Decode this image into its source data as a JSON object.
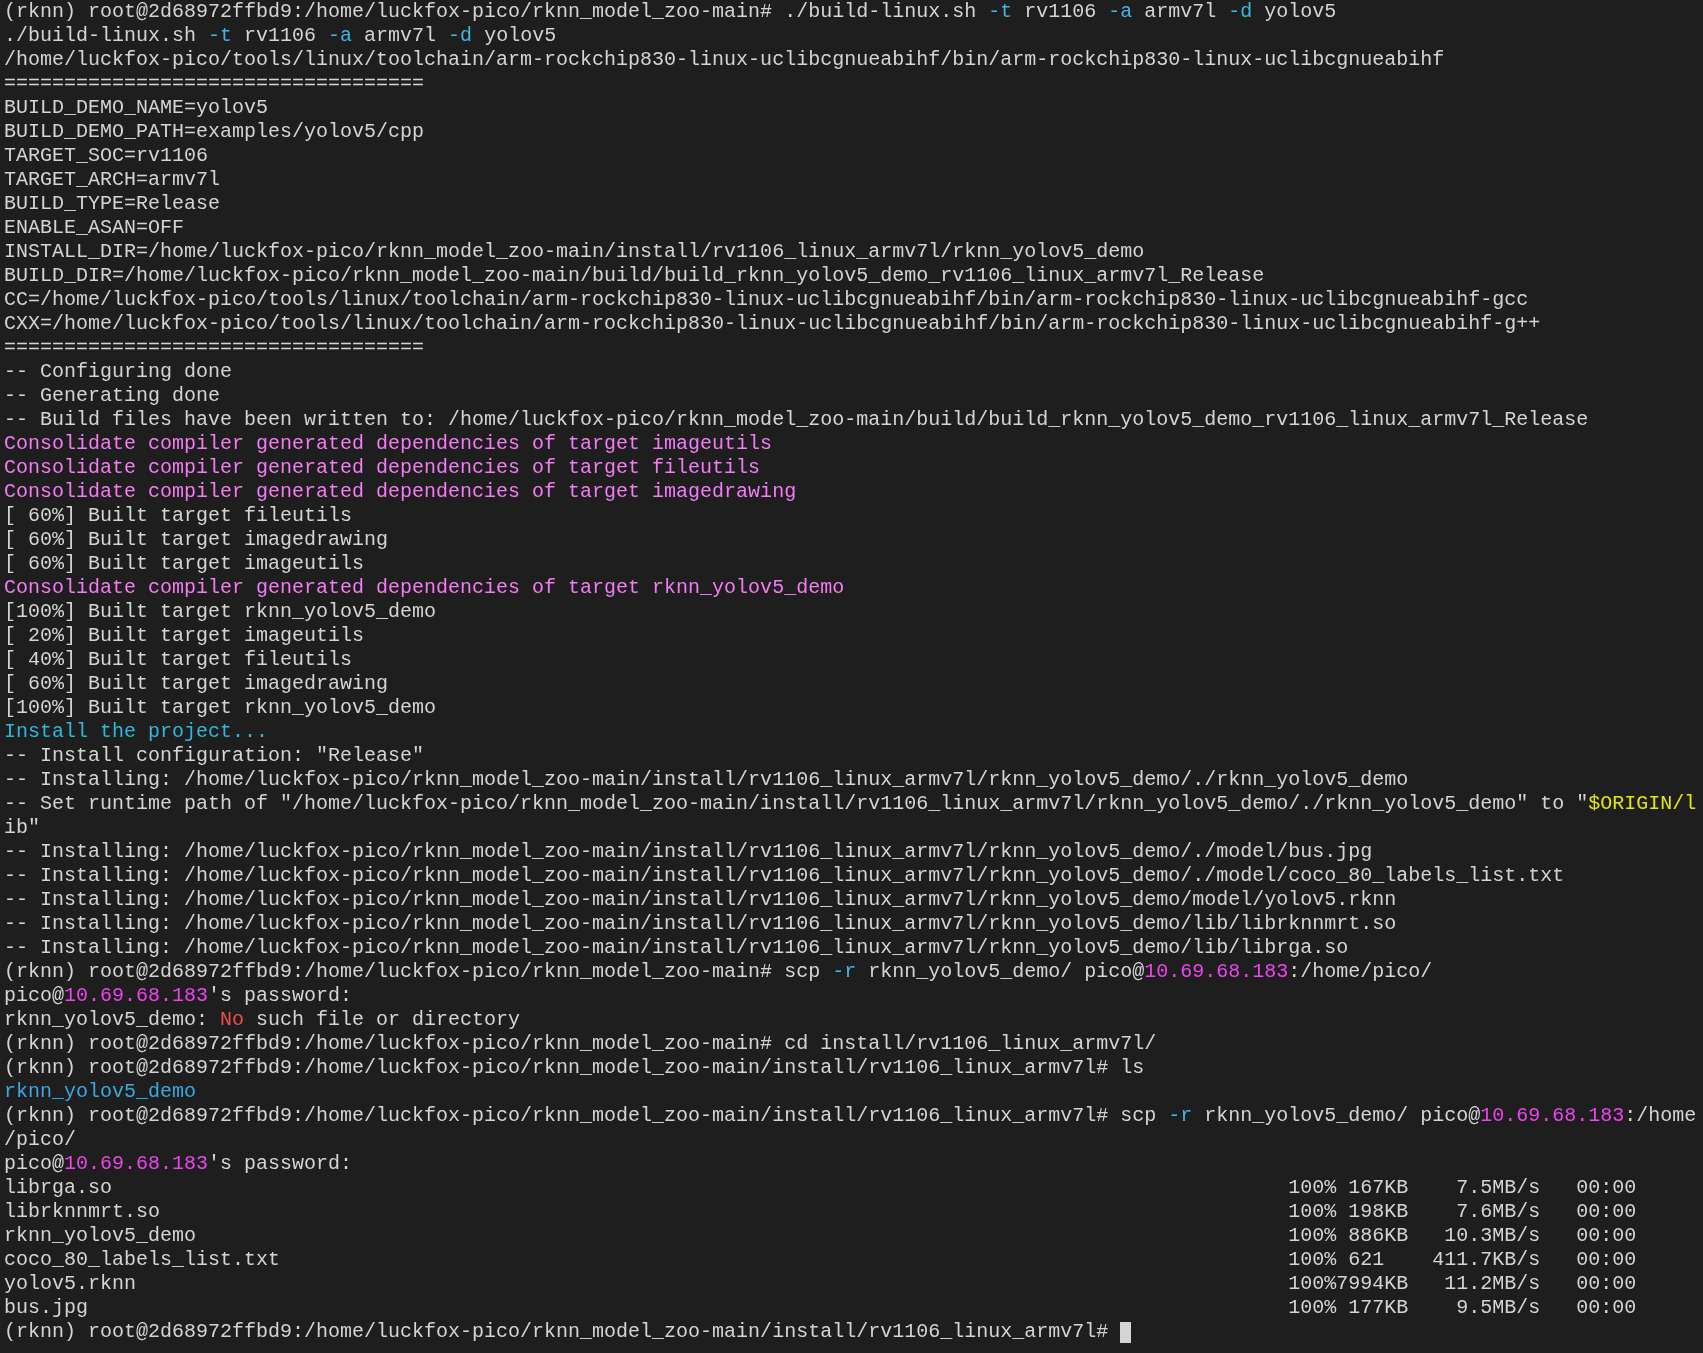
{
  "terminal": {
    "cursor_visible": true,
    "lines": [
      {
        "kind": "text",
        "segments": [
          {
            "text": "(rknn) root@2d68972ffbd9:/home/luckfox-pico/rknn_model_zoo-main# ./build-linux.sh "
          },
          {
            "text": "-t",
            "color": "#3fb6e6"
          },
          {
            "text": " rv1106 "
          },
          {
            "text": "-a",
            "color": "#3fb6e6"
          },
          {
            "text": " armv7l "
          },
          {
            "text": "-d",
            "color": "#3fb6e6"
          },
          {
            "text": " yolov5"
          }
        ]
      },
      {
        "kind": "text",
        "segments": [
          {
            "text": "./build-linux.sh "
          },
          {
            "text": "-t",
            "color": "#3fb6e6"
          },
          {
            "text": " rv1106 "
          },
          {
            "text": "-a",
            "color": "#3fb6e6"
          },
          {
            "text": " armv7l "
          },
          {
            "text": "-d",
            "color": "#3fb6e6"
          },
          {
            "text": " yolov5"
          }
        ]
      },
      {
        "kind": "text",
        "segments": [
          {
            "text": "/home/luckfox-pico/tools/linux/toolchain/arm-rockchip830-linux-uclibcgnueabihf/bin/arm-rockchip830-linux-uclibcgnueabihf"
          }
        ]
      },
      {
        "kind": "text",
        "segments": [
          {
            "text": "==================================="
          }
        ]
      },
      {
        "kind": "text",
        "segments": [
          {
            "text": "BUILD_DEMO_NAME=yolov5"
          }
        ]
      },
      {
        "kind": "text",
        "segments": [
          {
            "text": "BUILD_DEMO_PATH=examples/yolov5/cpp"
          }
        ]
      },
      {
        "kind": "text",
        "segments": [
          {
            "text": "TARGET_SOC=rv1106"
          }
        ]
      },
      {
        "kind": "text",
        "segments": [
          {
            "text": "TARGET_ARCH=armv7l"
          }
        ]
      },
      {
        "kind": "text",
        "segments": [
          {
            "text": "BUILD_TYPE=Release"
          }
        ]
      },
      {
        "kind": "text",
        "segments": [
          {
            "text": "ENABLE_ASAN=OFF"
          }
        ]
      },
      {
        "kind": "text",
        "segments": [
          {
            "text": "INSTALL_DIR=/home/luckfox-pico/rknn_model_zoo-main/install/rv1106_linux_armv7l/rknn_yolov5_demo"
          }
        ]
      },
      {
        "kind": "text",
        "segments": [
          {
            "text": "BUILD_DIR=/home/luckfox-pico/rknn_model_zoo-main/build/build_rknn_yolov5_demo_rv1106_linux_armv7l_Release"
          }
        ]
      },
      {
        "kind": "text",
        "segments": [
          {
            "text": "CC=/home/luckfox-pico/tools/linux/toolchain/arm-rockchip830-linux-uclibcgnueabihf/bin/arm-rockchip830-linux-uclibcgnueabihf-gcc"
          }
        ]
      },
      {
        "kind": "text",
        "segments": [
          {
            "text": "CXX=/home/luckfox-pico/tools/linux/toolchain/arm-rockchip830-linux-uclibcgnueabihf/bin/arm-rockchip830-linux-uclibcgnueabihf-g++"
          }
        ]
      },
      {
        "kind": "text",
        "segments": [
          {
            "text": "==================================="
          }
        ]
      },
      {
        "kind": "text",
        "segments": [
          {
            "text": "-- Configuring done"
          }
        ]
      },
      {
        "kind": "text",
        "segments": [
          {
            "text": "-- Generating done"
          }
        ]
      },
      {
        "kind": "text",
        "segments": [
          {
            "text": "-- Build files have been written to: /home/luckfox-pico/rknn_model_zoo-main/build/build_rknn_yolov5_demo_rv1106_linux_armv7l_Release"
          }
        ]
      },
      {
        "kind": "text",
        "segments": [
          {
            "text": "Consolidate compiler generated dependencies of target imageutils",
            "color": "#f47cf4"
          }
        ]
      },
      {
        "kind": "text",
        "segments": [
          {
            "text": "Consolidate compiler generated dependencies of target fileutils",
            "color": "#f47cf4"
          }
        ]
      },
      {
        "kind": "text",
        "segments": [
          {
            "text": "Consolidate compiler generated dependencies of target imagedrawing",
            "color": "#f47cf4"
          }
        ]
      },
      {
        "kind": "text",
        "segments": [
          {
            "text": "[ 60%] Built target fileutils"
          }
        ]
      },
      {
        "kind": "text",
        "segments": [
          {
            "text": "[ 60%] Built target imagedrawing"
          }
        ]
      },
      {
        "kind": "text",
        "segments": [
          {
            "text": "[ 60%] Built target imageutils"
          }
        ]
      },
      {
        "kind": "text",
        "segments": [
          {
            "text": "Consolidate compiler generated dependencies of target rknn_yolov5_demo",
            "color": "#f47cf4"
          }
        ]
      },
      {
        "kind": "text",
        "segments": [
          {
            "text": "[100%] Built target rknn_yolov5_demo"
          }
        ]
      },
      {
        "kind": "text",
        "segments": [
          {
            "text": "[ 20%] Built target imageutils"
          }
        ]
      },
      {
        "kind": "text",
        "segments": [
          {
            "text": "[ 40%] Built target fileutils"
          }
        ]
      },
      {
        "kind": "text",
        "segments": [
          {
            "text": "[ 60%] Built target imagedrawing"
          }
        ]
      },
      {
        "kind": "text",
        "segments": [
          {
            "text": "[100%] Built target rknn_yolov5_demo"
          }
        ]
      },
      {
        "kind": "text",
        "segments": [
          {
            "text": "Install the project...",
            "color": "#2fb8db"
          }
        ]
      },
      {
        "kind": "text",
        "segments": [
          {
            "text": "-- Install configuration: \"Release\""
          }
        ]
      },
      {
        "kind": "text",
        "segments": [
          {
            "text": "-- Installing: /home/luckfox-pico/rknn_model_zoo-main/install/rv1106_linux_armv7l/rknn_yolov5_demo/./rknn_yolov5_demo"
          }
        ]
      },
      {
        "kind": "text",
        "segments": [
          {
            "text": "-- Set runtime path of \"/home/luckfox-pico/rknn_model_zoo-main/install/rv1106_linux_armv7l/rknn_yolov5_demo/./rknn_yolov5_demo\" to \""
          },
          {
            "text": "$ORIGIN/l",
            "color": "#e5e510"
          }
        ]
      },
      {
        "kind": "text",
        "segments": [
          {
            "text": "ib\""
          }
        ]
      },
      {
        "kind": "text",
        "segments": [
          {
            "text": "-- Installing: /home/luckfox-pico/rknn_model_zoo-main/install/rv1106_linux_armv7l/rknn_yolov5_demo/./model/bus.jpg"
          }
        ]
      },
      {
        "kind": "text",
        "segments": [
          {
            "text": "-- Installing: /home/luckfox-pico/rknn_model_zoo-main/install/rv1106_linux_armv7l/rknn_yolov5_demo/./model/coco_80_labels_list.txt"
          }
        ]
      },
      {
        "kind": "text",
        "segments": [
          {
            "text": "-- Installing: /home/luckfox-pico/rknn_model_zoo-main/install/rv1106_linux_armv7l/rknn_yolov5_demo/model/yolov5.rknn"
          }
        ]
      },
      {
        "kind": "text",
        "segments": [
          {
            "text": "-- Installing: /home/luckfox-pico/rknn_model_zoo-main/install/rv1106_linux_armv7l/rknn_yolov5_demo/lib/librknnmrt.so"
          }
        ]
      },
      {
        "kind": "text",
        "segments": [
          {
            "text": "-- Installing: /home/luckfox-pico/rknn_model_zoo-main/install/rv1106_linux_armv7l/rknn_yolov5_demo/lib/librga.so"
          }
        ]
      },
      {
        "kind": "text",
        "segments": [
          {
            "text": "(rknn) root@2d68972ffbd9:/home/luckfox-pico/rknn_model_zoo-main# scp "
          },
          {
            "text": "-r",
            "color": "#3fb6e6"
          },
          {
            "text": " rknn_yolov5_demo/ pico@"
          },
          {
            "text": "10.69.68.183",
            "color": "#ee44ee"
          },
          {
            "text": ":/home/pico/"
          }
        ]
      },
      {
        "kind": "text",
        "segments": [
          {
            "text": "pico@"
          },
          {
            "text": "10.69.68.183",
            "color": "#ee44ee"
          },
          {
            "text": "'s password:"
          }
        ]
      },
      {
        "kind": "text",
        "segments": [
          {
            "text": "rknn_yolov5_demo: "
          },
          {
            "text": "No",
            "color": "#f14c4c"
          },
          {
            "text": " such file or directory"
          }
        ]
      },
      {
        "kind": "text",
        "segments": [
          {
            "text": "(rknn) root@2d68972ffbd9:/home/luckfox-pico/rknn_model_zoo-main# cd install/rv1106_linux_armv7l/"
          }
        ]
      },
      {
        "kind": "text",
        "segments": [
          {
            "text": "(rknn) root@2d68972ffbd9:/home/luckfox-pico/rknn_model_zoo-main/install/rv1106_linux_armv7l# ls"
          }
        ]
      },
      {
        "kind": "text",
        "segments": [
          {
            "text": "rknn_yolov5_demo",
            "color": "#3ba8e0"
          }
        ]
      },
      {
        "kind": "text",
        "segments": [
          {
            "text": "(rknn) root@2d68972ffbd9:/home/luckfox-pico/rknn_model_zoo-main/install/rv1106_linux_armv7l# scp "
          },
          {
            "text": "-r",
            "color": "#3fb6e6"
          },
          {
            "text": " rknn_yolov5_demo/ pico@"
          },
          {
            "text": "10.69.68.183",
            "color": "#ee44ee"
          },
          {
            "text": ":/home"
          }
        ]
      },
      {
        "kind": "text",
        "segments": [
          {
            "text": "/pico/"
          }
        ]
      },
      {
        "kind": "text",
        "segments": [
          {
            "text": "pico@"
          },
          {
            "text": "10.69.68.183",
            "color": "#ee44ee"
          },
          {
            "text": "'s password:"
          }
        ]
      },
      {
        "kind": "transfer",
        "file": "librga.so",
        "percent": "100%",
        "size": "167KB",
        "speed": "7.5MB/s",
        "time": "00:00"
      },
      {
        "kind": "transfer",
        "file": "librknnmrt.so",
        "percent": "100%",
        "size": "198KB",
        "speed": "7.6MB/s",
        "time": "00:00"
      },
      {
        "kind": "transfer",
        "file": "rknn_yolov5_demo",
        "percent": "100%",
        "size": "886KB",
        "speed": "10.3MB/s",
        "time": "00:00"
      },
      {
        "kind": "transfer",
        "file": "coco_80_labels_list.txt",
        "percent": "100%",
        "size": "621",
        "speed": "411.7KB/s",
        "time": "00:00"
      },
      {
        "kind": "transfer",
        "file": "yolov5.rknn",
        "percent": "100%",
        "size": "7994KB",
        "speed": "11.2MB/s",
        "time": "00:00"
      },
      {
        "kind": "transfer",
        "file": "bus.jpg",
        "percent": "100%",
        "size": "177KB",
        "speed": "9.5MB/s",
        "time": "00:00"
      },
      {
        "kind": "text",
        "segments": [
          {
            "text": "(rknn) root@2d68972ffbd9:/home/luckfox-pico/rknn_model_zoo-main/install/rv1106_linux_armv7l# "
          }
        ]
      }
    ]
  }
}
